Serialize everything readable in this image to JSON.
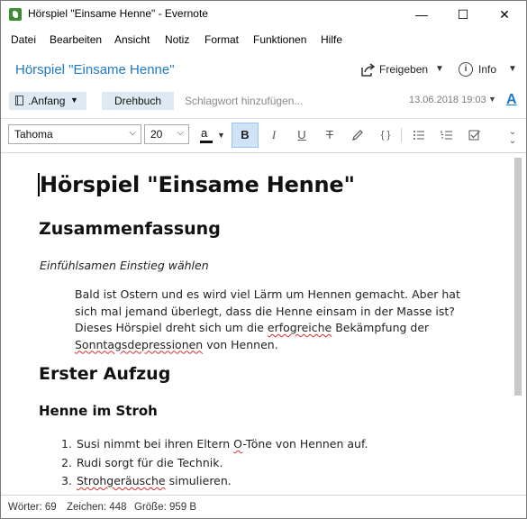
{
  "window": {
    "title": "Hörspiel \"Einsame Henne\" - Evernote",
    "minimize": "—",
    "maximize": "☐",
    "close": "✕"
  },
  "menu": [
    "Datei",
    "Bearbeiten",
    "Ansicht",
    "Notiz",
    "Format",
    "Funktionen",
    "Hilfe"
  ],
  "note_header": {
    "title": "Hörspiel \"Einsame Henne\"",
    "share_label": "Freigeben",
    "info_label": "Info"
  },
  "meta_row": {
    "notebook": ".Anfang",
    "tag": "Drehbuch",
    "tag_placeholder": "Schlagwort hinzufügen...",
    "date": "13.06.2018 19:03"
  },
  "toolbar": {
    "font": "Tahoma",
    "size": "20",
    "color_letter": "a",
    "bold": "B",
    "italic": "I",
    "underline": "U",
    "strike": "T",
    "code": "{ }",
    "font_icon": "A"
  },
  "content": {
    "h1": "Hörspiel \"Einsame Henne\"",
    "summary_heading": "Zusammenfassung",
    "italic_note": "Einfühlsamen Einstieg wählen",
    "paragraph": {
      "line1": "Bald ist Ostern und es wird viel Lärm um Hennen gemacht. Aber hat",
      "line2": "sich mal jemand überlegt, dass die Henne einsam in der Masse ist?",
      "line3_pre": "Dieses Hörspiel dreht sich um die ",
      "line3_misspelled": "erfogreiche",
      "line3_post": " Bekämpfung der",
      "line4_misspelled": "Sonntagsdepressionen",
      "line4_post": " von Hennen."
    },
    "act_heading": "Erster Aufzug",
    "scene_heading": "Henne im Stroh",
    "list": [
      {
        "num": "1.",
        "pre": "Susi nimmt bei ihren Eltern ",
        "mis": "O",
        "post": "-Töne von Hennen auf."
      },
      {
        "num": "2.",
        "pre": "Rudi sorgt für die Technik.",
        "mis": "",
        "post": ""
      },
      {
        "num": "3.",
        "pre": "",
        "mis": "Strohgeräusche",
        "post": " simulieren."
      }
    ]
  },
  "status": {
    "words": "Wörter: 69",
    "chars": "Zeichen: 448",
    "size": "Größe: 959 B"
  },
  "colors": {
    "accent": "#1e7ac8",
    "app_green": "#3c8d34",
    "chip_bg": "#dfe9f3",
    "spell_error": "#d83030"
  }
}
